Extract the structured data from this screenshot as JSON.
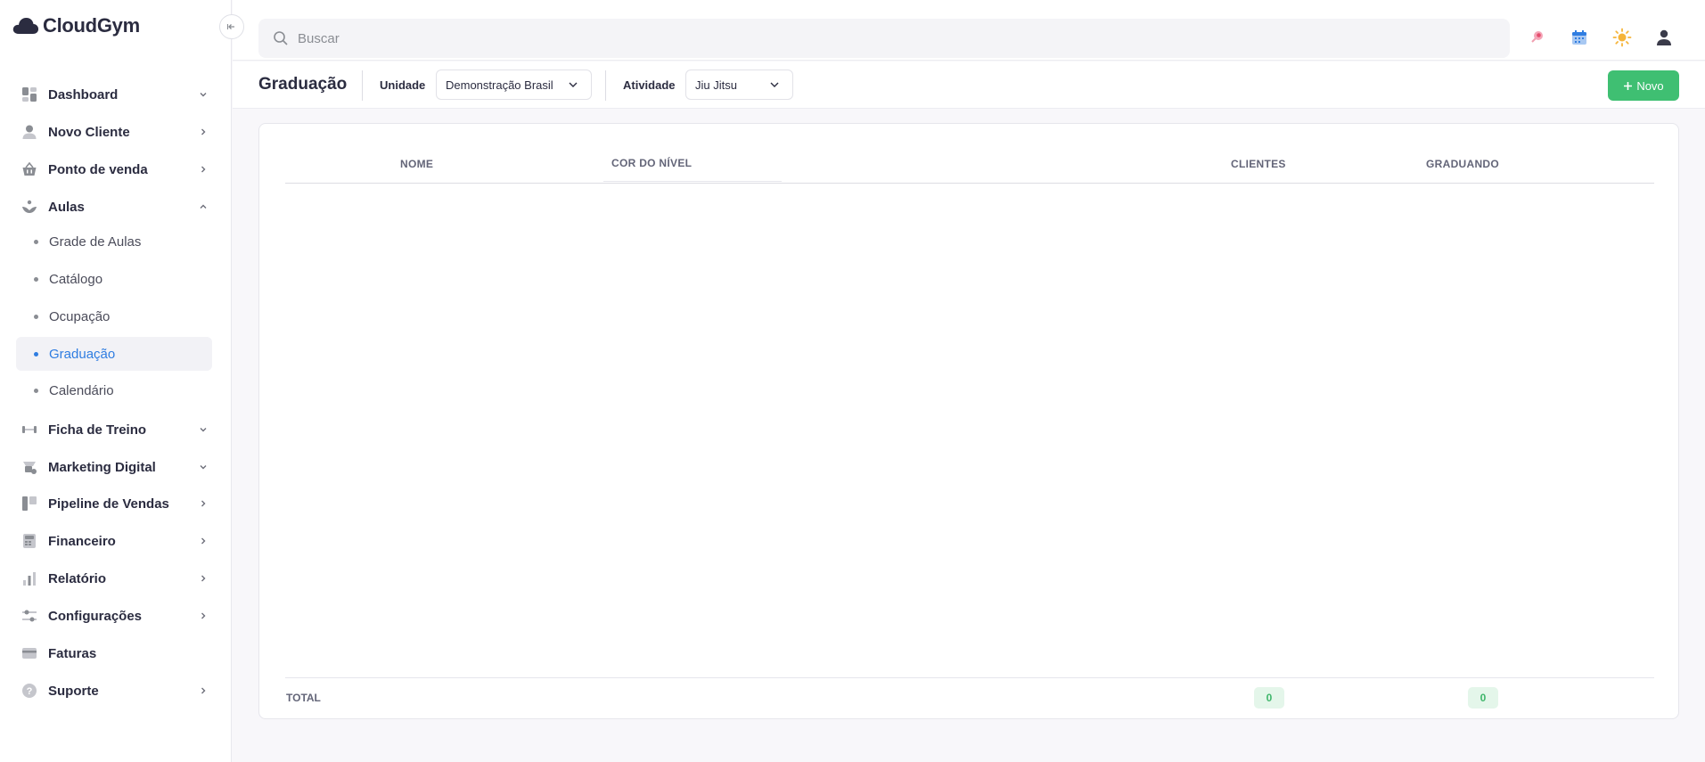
{
  "brand": {
    "name": "CloudGym"
  },
  "sidebar": {
    "items": [
      {
        "label": "Dashboard",
        "icon": "dashboard-icon",
        "chevron": "down"
      },
      {
        "label": "Novo Cliente",
        "icon": "user-icon",
        "chevron": "right"
      },
      {
        "label": "Ponto de venda",
        "icon": "basket-icon",
        "chevron": "right"
      },
      {
        "label": "Aulas",
        "icon": "yoga-icon",
        "chevron": "up",
        "expanded": true,
        "children": [
          {
            "label": "Grade de Aulas"
          },
          {
            "label": "Catálogo"
          },
          {
            "label": "Ocupação"
          },
          {
            "label": "Graduação",
            "active": true
          },
          {
            "label": "Calendário"
          }
        ]
      },
      {
        "label": "Ficha de Treino",
        "icon": "dumbbell-icon",
        "chevron": "down"
      },
      {
        "label": "Marketing Digital",
        "icon": "megaphone-icon",
        "chevron": "down"
      },
      {
        "label": "Pipeline de Vendas",
        "icon": "pipeline-icon",
        "chevron": "right"
      },
      {
        "label": "Financeiro",
        "icon": "register-icon",
        "chevron": "right"
      },
      {
        "label": "Relatório",
        "icon": "bar-chart-icon",
        "chevron": "right"
      },
      {
        "label": "Configurações",
        "icon": "sliders-icon",
        "chevron": "right"
      },
      {
        "label": "Faturas",
        "icon": "credit-card-icon",
        "chevron": "none"
      },
      {
        "label": "Suporte",
        "icon": "help-icon",
        "chevron": "right"
      }
    ]
  },
  "search": {
    "placeholder": "Buscar"
  },
  "topbar": {
    "icons": [
      "rocket-icon",
      "calendar-icon",
      "sun-icon",
      "profile-icon"
    ]
  },
  "page": {
    "title": "Graduação",
    "filters": {
      "unidade_label": "Unidade",
      "unidade_value": "Demonstração Brasil",
      "atividade_label": "Atividade",
      "atividade_value": "Jiu Jitsu"
    },
    "new_button": "Novo"
  },
  "table": {
    "columns": [
      "NOME",
      "COR DO NÍVEL",
      "CLIENTES",
      "GRADUANDO"
    ],
    "rows": [],
    "footer": {
      "label": "TOTAL",
      "clientes": "0",
      "graduando": "0"
    }
  },
  "colors": {
    "accent": "#2f7de1",
    "success": "#3fbf72",
    "badge_bg": "#e4f6ea"
  }
}
